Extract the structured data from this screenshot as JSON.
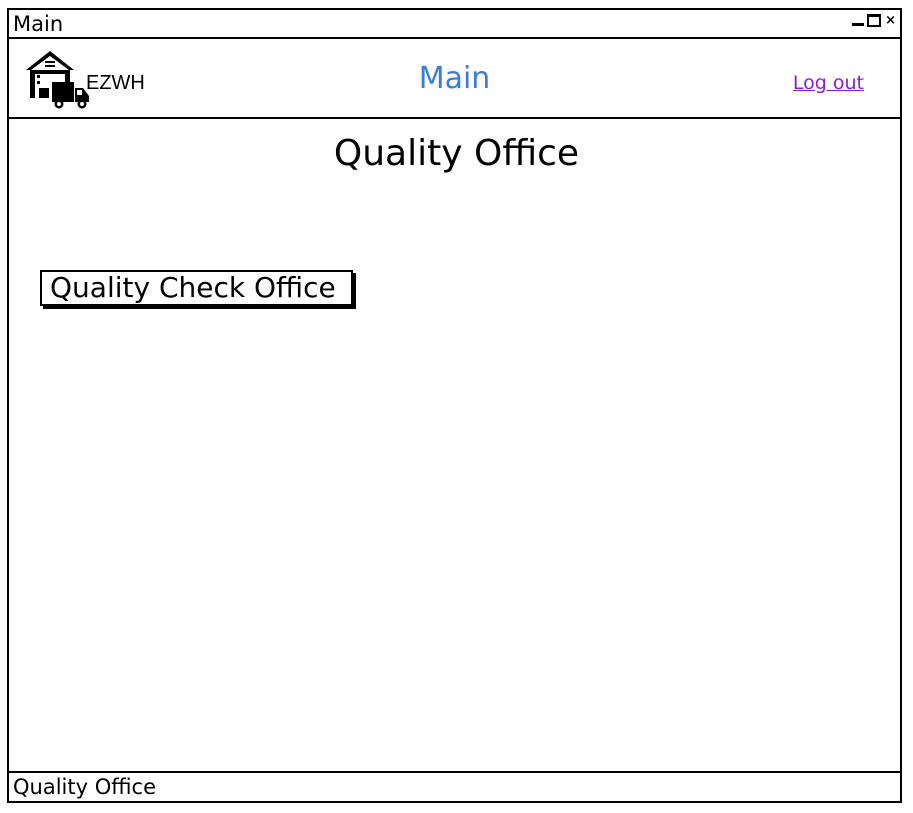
{
  "window": {
    "title": "Main",
    "controls": [
      "minimize-icon",
      "maximize-icon",
      "close-icon"
    ],
    "close_glyph": "×"
  },
  "header": {
    "logo_icon": "warehouse-truck-icon",
    "brand": "EZWH",
    "title": "Main",
    "logout_label": "Log out"
  },
  "page": {
    "title": "Quality Office",
    "button_label": "Quality Check Office"
  },
  "status_bar": {
    "text": "Quality Office"
  },
  "colors": {
    "header_title": "#3c7fd0",
    "link": "#8a1fd1"
  }
}
